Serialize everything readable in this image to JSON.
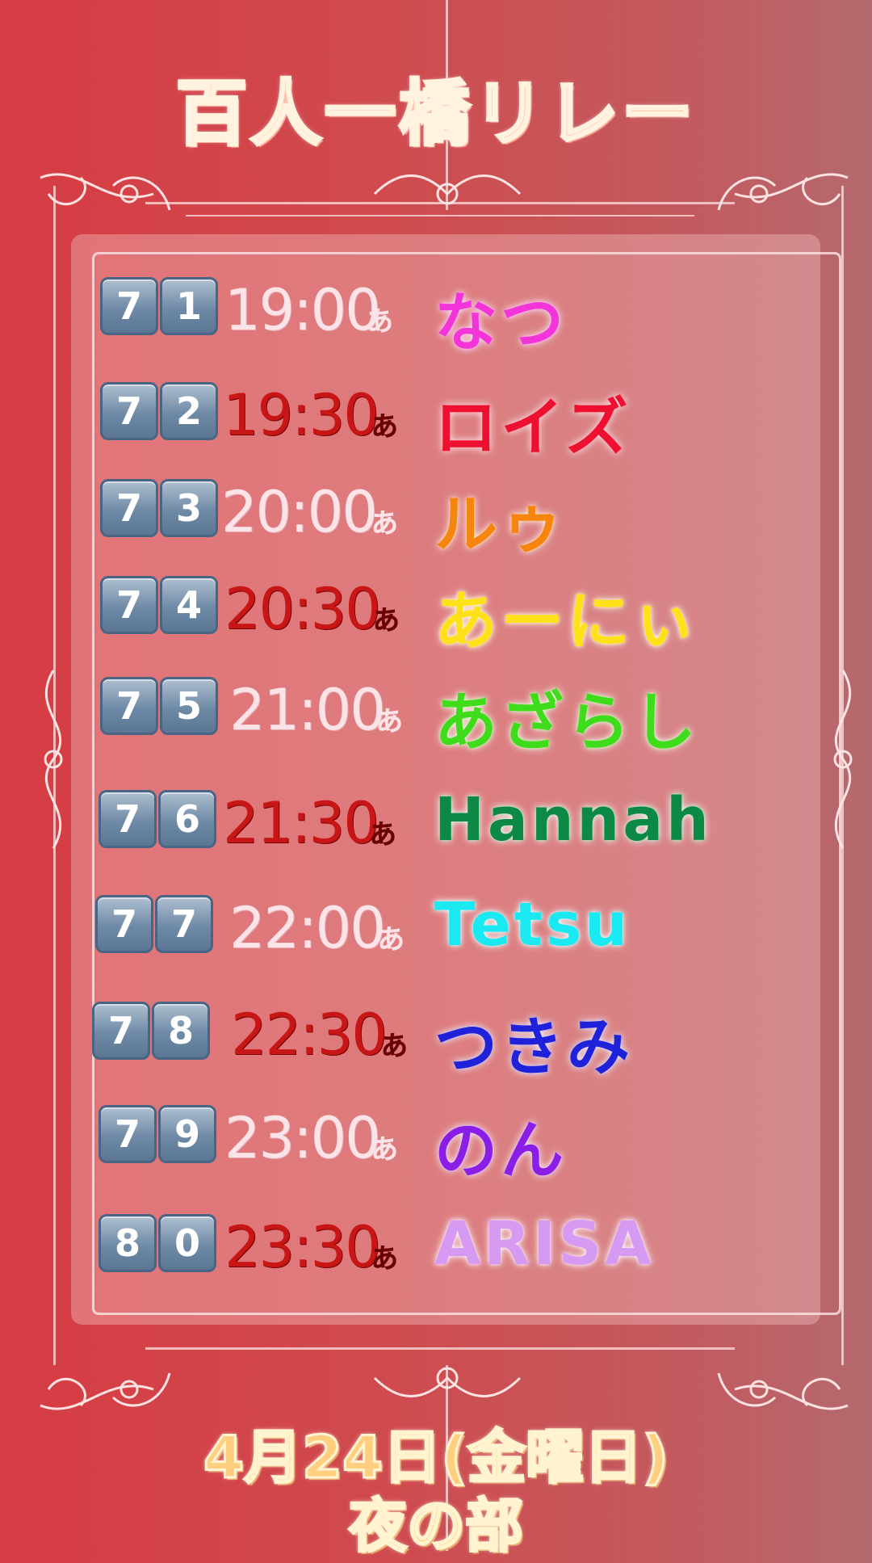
{
  "header": {
    "title": "百人一橋リレー"
  },
  "schedule": [
    {
      "d1": "7",
      "d2": "1",
      "time": "19:00",
      "suffix": "ぁ",
      "name": "なつ",
      "name_color": "#f234d8",
      "time_style": "light"
    },
    {
      "d1": "7",
      "d2": "2",
      "time": "19:30",
      "suffix": "ぁ",
      "name": "ロイズ",
      "name_color": "#ee1030",
      "time_style": "dark"
    },
    {
      "d1": "7",
      "d2": "3",
      "time": "20:00",
      "suffix": "ぁ",
      "name": "ルゥ",
      "name_color": "#f5850c",
      "time_style": "light"
    },
    {
      "d1": "7",
      "d2": "4",
      "time": "20:30",
      "suffix": "ぁ",
      "name": "あーにぃ",
      "name_color": "#ffe11a",
      "time_style": "dark"
    },
    {
      "d1": "7",
      "d2": "5",
      "time": "21:00",
      "suffix": "ぁ",
      "name": "あざらし",
      "name_color": "#3fdc1c",
      "time_style": "light"
    },
    {
      "d1": "7",
      "d2": "6",
      "time": "21:30",
      "suffix": "ぁ",
      "name": "Hannah",
      "name_color": "#0c8a45",
      "time_style": "dark"
    },
    {
      "d1": "7",
      "d2": "7",
      "time": "22:00",
      "suffix": "ぁ",
      "name": "Tetsu",
      "name_color": "#1ae9f2",
      "time_style": "light"
    },
    {
      "d1": "7",
      "d2": "8",
      "time": "22:30",
      "suffix": "ぁ",
      "name": "つきみ",
      "name_color": "#1f22d8",
      "time_style": "dark"
    },
    {
      "d1": "7",
      "d2": "9",
      "time": "23:00",
      "suffix": "ぁ",
      "name": "のん",
      "name_color": "#8b1ee6",
      "time_style": "light"
    },
    {
      "d1": "8",
      "d2": "0",
      "time": "23:30",
      "suffix": "ぁ",
      "name": "ARISA",
      "name_color": "#d79af2",
      "time_style": "dark"
    }
  ],
  "footer": {
    "date": "4月24日(金曜日)",
    "session": "夜の部"
  }
}
